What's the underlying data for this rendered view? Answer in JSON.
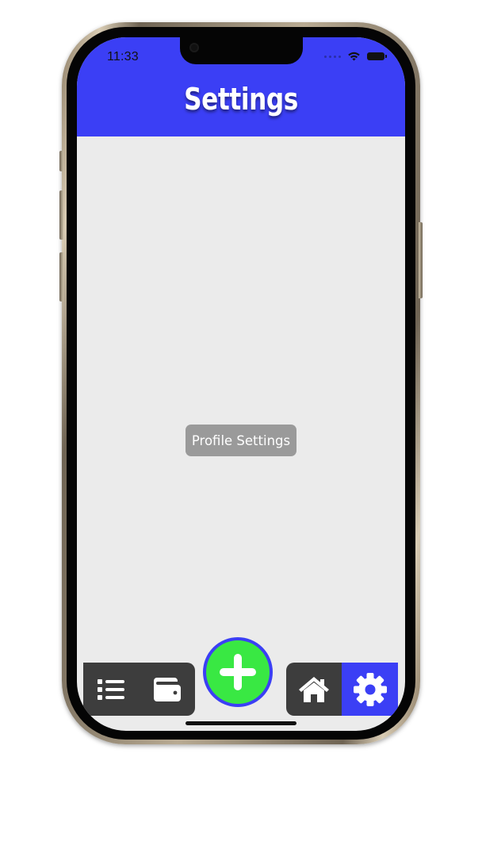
{
  "status_bar": {
    "time": "11:33"
  },
  "header": {
    "title": "Settings"
  },
  "main": {
    "profile_button_label": "Profile Settings"
  },
  "tab_bar": {
    "items": [
      {
        "icon": "list-icon",
        "active": false
      },
      {
        "icon": "wallet-icon",
        "active": false
      },
      {
        "icon": "plus-icon",
        "kind": "floating-action"
      },
      {
        "icon": "home-icon",
        "active": false
      },
      {
        "icon": "gear-icon",
        "active": true
      }
    ]
  },
  "colors": {
    "accent": "#3b3ff5",
    "fab": "#39e843",
    "tab_bar": "#3d3d3d",
    "screen_background": "#ebebeb",
    "button_gray": "#9a9a9a"
  }
}
